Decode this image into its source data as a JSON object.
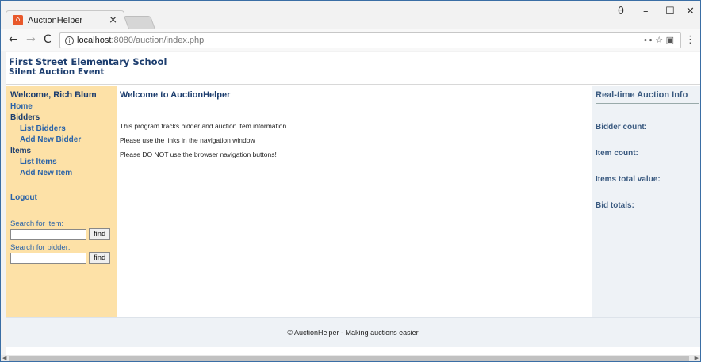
{
  "browser": {
    "tab_title": "AuctionHelper",
    "tab_close": "×",
    "tab_favicon": "ah-icon",
    "url_host": "localhost",
    "url_path": ":8080/auction/index.php",
    "window_controls": {
      "minimize": "–",
      "maximize": "☐",
      "close": "✕",
      "profile": "θ"
    },
    "nav": {
      "back": "←",
      "forward": "→",
      "reload": "C"
    },
    "info_icon": "i",
    "omni_icons": {
      "key": "⊶",
      "star": "☆",
      "ext": "▣"
    },
    "menu": "⋮"
  },
  "header": {
    "school": "First Street Elementary School",
    "event": "Silent Auction Event"
  },
  "sidebar": {
    "welcome": "Welcome, Rich Blum",
    "home": "Home",
    "bidders_heading": "Bidders",
    "list_bidders": "List Bidders",
    "add_bidder": "Add New Bidder",
    "items_heading": "Items",
    "list_items": "List Items",
    "add_item": "Add New Item",
    "logout": "Logout",
    "search_item_label": "Search for item:",
    "search_bidder_label": "Search for bidder:",
    "find_label": "find"
  },
  "main": {
    "title": "Welcome to AuctionHelper",
    "paragraphs": [
      "This program tracks bidder and auction item information",
      "Please use the links in the navigation window",
      "Please DO NOT use the browser navigation buttons!"
    ]
  },
  "right_panel": {
    "title": "Real-time Auction Info",
    "items": [
      "Bidder count:",
      "Item count:",
      "Items total value:",
      "Bid totals:"
    ]
  },
  "footer": {
    "text": "© AuctionHelper - Making auctions easier"
  },
  "colors": {
    "sidebar_bg": "#fde1a7",
    "panel_bg": "#eef2f6",
    "heading": "#1c3d6e",
    "link": "#2a63a8"
  }
}
